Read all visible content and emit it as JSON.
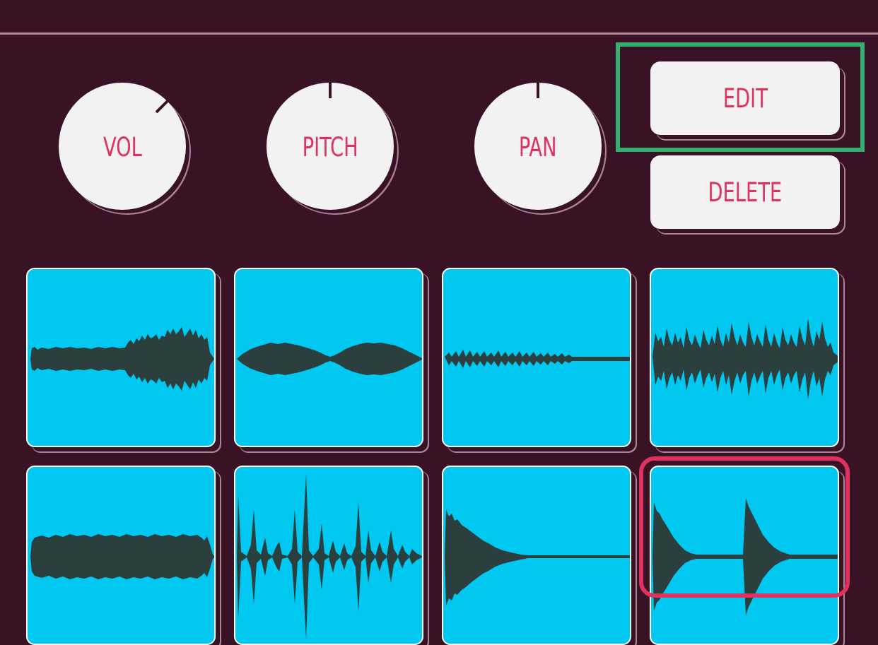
{
  "knobs": [
    {
      "id": "vol",
      "label": "VOL"
    },
    {
      "id": "pitch",
      "label": "PITCH"
    },
    {
      "id": "pan",
      "label": "PAN"
    }
  ],
  "buttons": {
    "edit_label": "EDIT",
    "delete_label": "DELETE"
  },
  "pads": [
    {
      "row": 1,
      "col": 1,
      "waveform": "soft-then-spiky"
    },
    {
      "row": 1,
      "col": 2,
      "waveform": "two-swells"
    },
    {
      "row": 1,
      "col": 3,
      "waveform": "short-ticks"
    },
    {
      "row": 1,
      "col": 4,
      "waveform": "periodic-spikes"
    },
    {
      "row": 2,
      "col": 1,
      "waveform": "sustained"
    },
    {
      "row": 2,
      "col": 2,
      "waveform": "tall-spikes"
    },
    {
      "row": 2,
      "col": 3,
      "waveform": "decay"
    },
    {
      "row": 2,
      "col": 4,
      "waveform": "two-decays",
      "selected": true
    }
  ],
  "colors": {
    "background": "#3a1225",
    "knob": "#f3f2f2",
    "accent": "#e0325f",
    "pad": "#00c8f0",
    "waveform": "#2b3f3f",
    "highlight": "#35b06f"
  }
}
